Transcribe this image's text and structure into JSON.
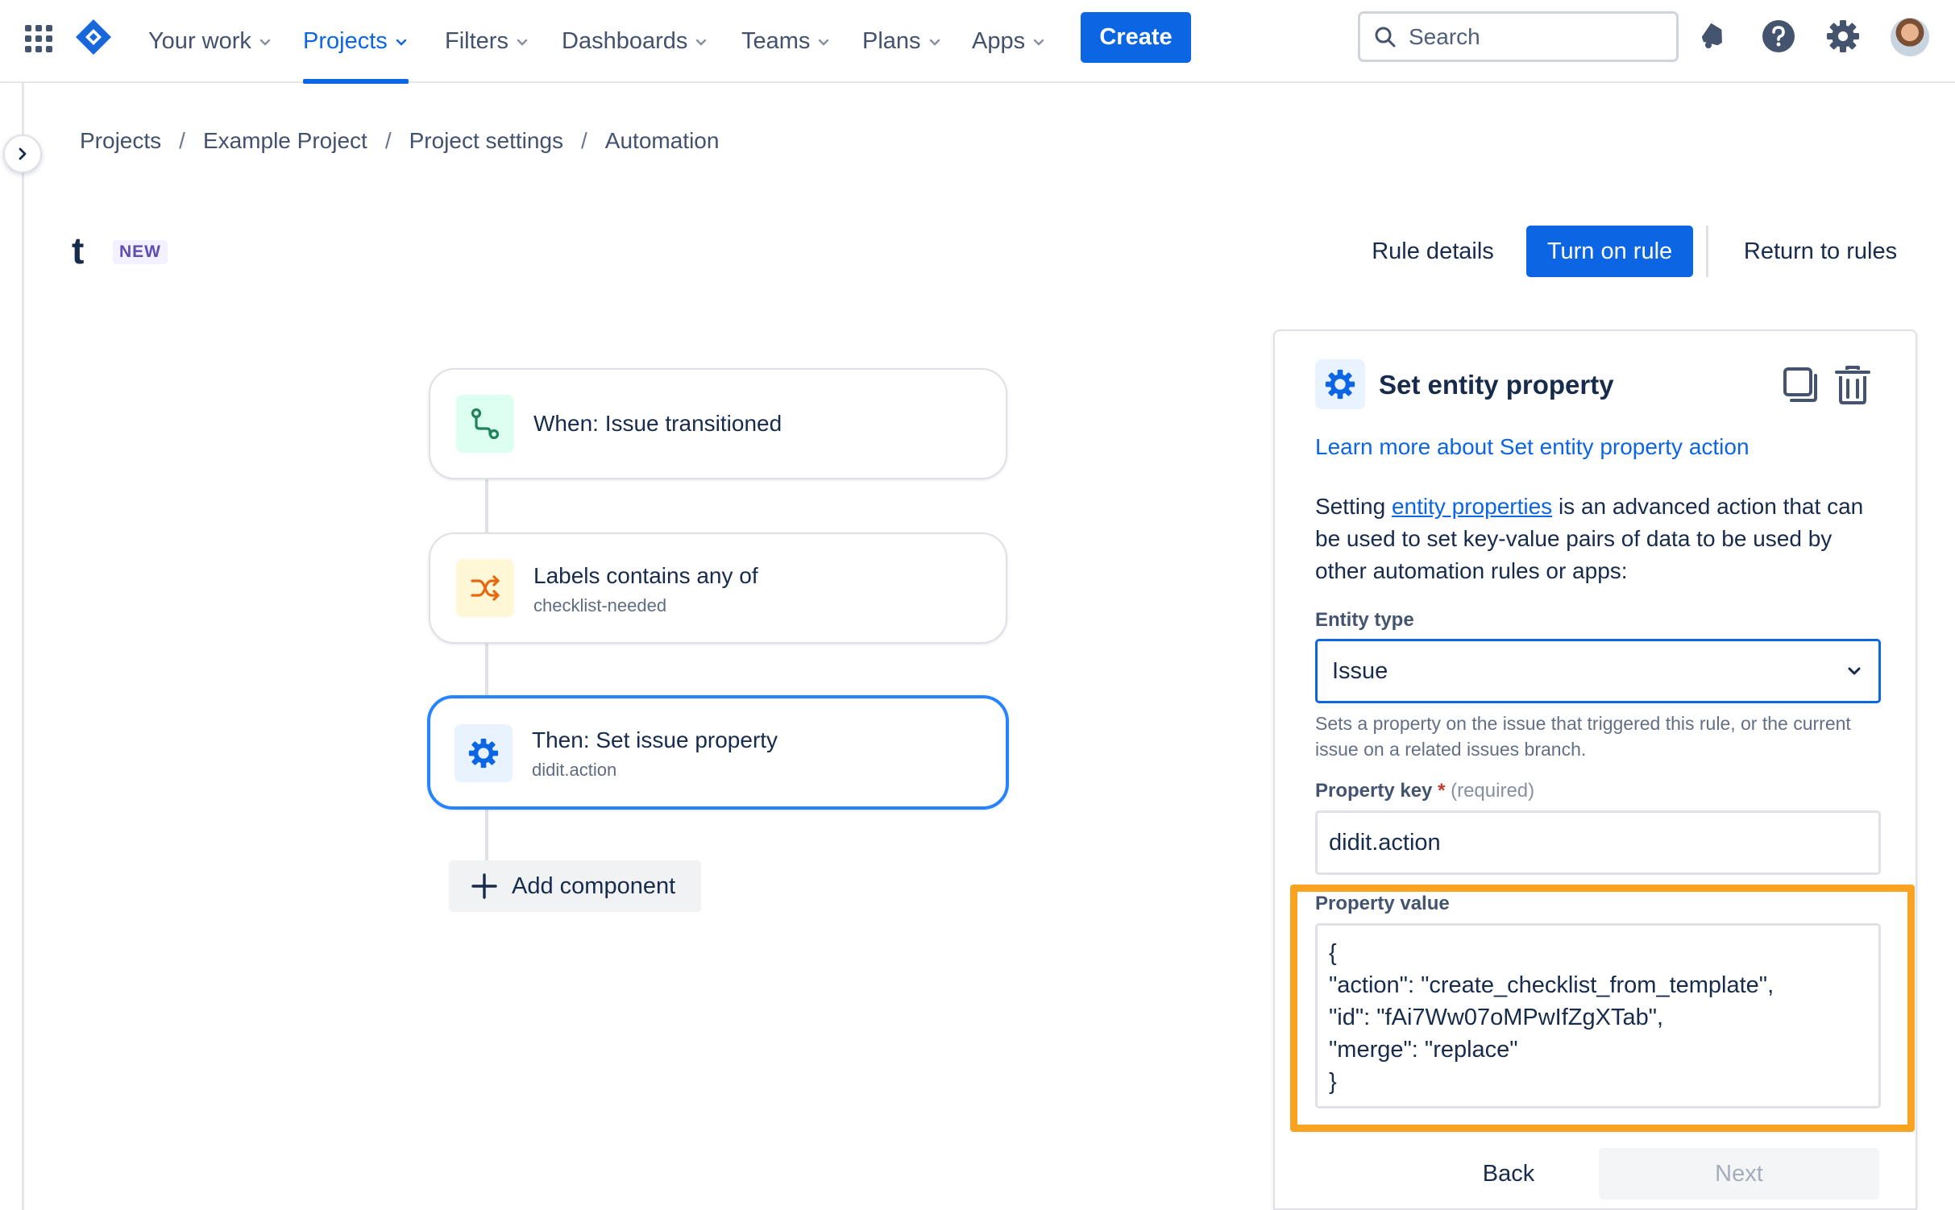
{
  "nav": {
    "items": [
      {
        "label": "Your work",
        "active": false
      },
      {
        "label": "Projects",
        "active": true
      },
      {
        "label": "Filters",
        "active": false
      },
      {
        "label": "Dashboards",
        "active": false
      },
      {
        "label": "Teams",
        "active": false
      },
      {
        "label": "Plans",
        "active": false
      },
      {
        "label": "Apps",
        "active": false
      }
    ],
    "create_label": "Create",
    "search_placeholder": "Search",
    "accent_color": "#0c66e4"
  },
  "breadcrumb": [
    "Projects",
    "Example Project",
    "Project settings",
    "Automation"
  ],
  "rule": {
    "name": "t",
    "badge": "NEW",
    "rule_details_label": "Rule details",
    "turn_on_label": "Turn on rule",
    "return_label": "Return to rules"
  },
  "flow": {
    "trigger": {
      "title": "When: Issue transitioned",
      "icon": "transition-icon"
    },
    "condition": {
      "title": "Labels contains any of",
      "subtitle": "checklist-needed",
      "icon": "shuffle-icon"
    },
    "action": {
      "title": "Then: Set issue property",
      "subtitle": "didit.action",
      "icon": "gear-icon"
    },
    "add_component_label": "Add component"
  },
  "panel": {
    "title": "Set entity property",
    "learn_more": "Learn more about Set entity property action",
    "desc_before": "Setting ",
    "desc_link": "entity properties",
    "desc_after": " is an advanced action that can be used to set key-value pairs of data to be used by other automation rules or apps:",
    "entity_type_label": "Entity type",
    "entity_type_value": "Issue",
    "entity_help": "Sets a property on the issue that triggered this rule, or the current issue on a related issues branch.",
    "property_key_label": "Property key",
    "required_star": "*",
    "required_text": "(required)",
    "property_key_value": "didit.action",
    "property_value_label": "Property value",
    "property_value_lines": [
      "{",
      "\"action\": \"create_checklist_from_template\",",
      "\"id\": \"fAi7Ww07oMPwIfZgXTab\",",
      "\"merge\": \"replace\"",
      "}"
    ],
    "back_label": "Back",
    "next_label": "Next",
    "highlight_color": "#faa321"
  }
}
